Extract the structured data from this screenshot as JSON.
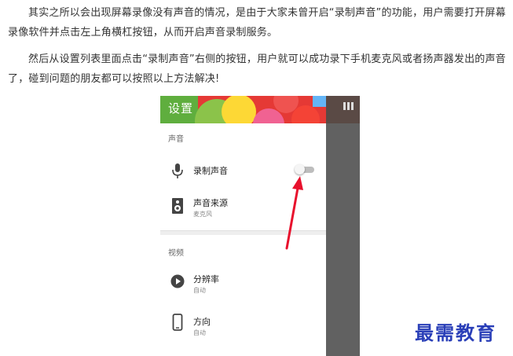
{
  "article": {
    "paragraph1": "其实之所以会出现屏幕录像没有声音的情况，是由于大家未曾开启“录制声音”的功能，用户需要打开屏幕录像软件并点击左上角横杠按钮，从而开启声音录制服务。",
    "paragraph2": "然后从设置列表里面点击“录制声音”右侧的按钮，用户就可以成功录下手机麦克风或者扬声器发出的声音了，碰到问题的朋友都可以按照以上方法解决!"
  },
  "phone": {
    "header_title": "设置",
    "sections": {
      "audio": "声音",
      "video": "视频"
    },
    "items": {
      "record_audio": {
        "title": "录制声音",
        "icon": "microphone-icon",
        "toggle_on": false
      },
      "audio_source": {
        "title": "声音来源",
        "subtitle": "麦克风",
        "icon": "speaker-icon"
      },
      "resolution": {
        "title": "分辨率",
        "subtitle": "自动",
        "icon": "play-icon"
      },
      "orientation": {
        "title": "方向",
        "subtitle": "自动",
        "icon": "phone-icon"
      }
    }
  },
  "watermark": "最需教育",
  "colors": {
    "annotation_arrow": "#e8112d",
    "watermark": "#2a3fb8"
  }
}
